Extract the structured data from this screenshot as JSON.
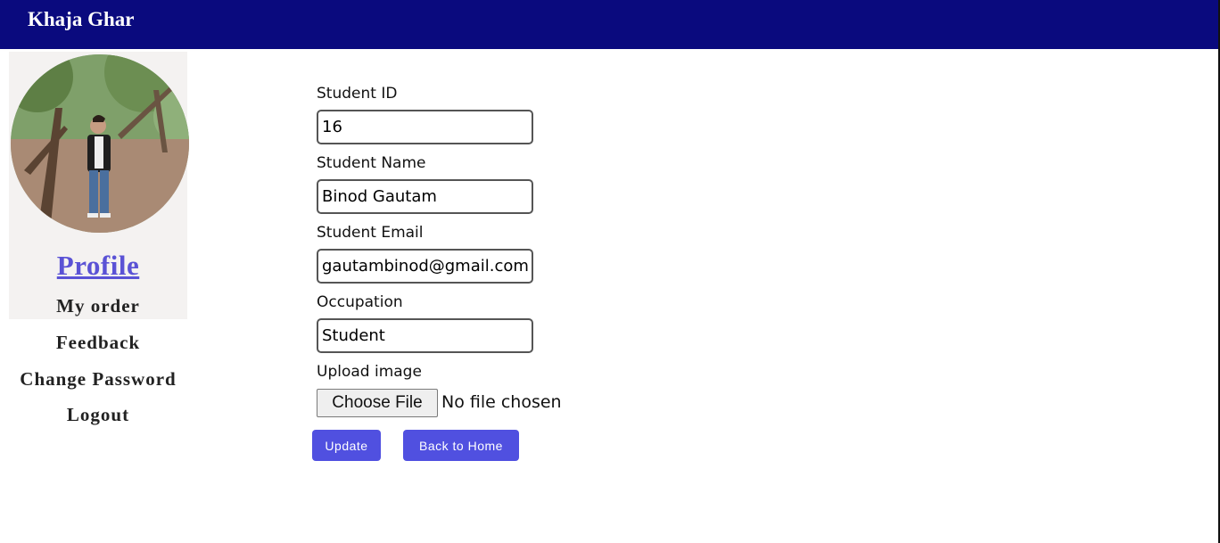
{
  "header": {
    "brand": "Khaja Ghar"
  },
  "sidebar": {
    "avatar_icon": "profile-photo",
    "items": [
      {
        "label": "Profile"
      },
      {
        "label": "My order"
      },
      {
        "label": "Feedback"
      },
      {
        "label": "Change Password"
      },
      {
        "label": "Logout"
      }
    ]
  },
  "form": {
    "student_id": {
      "label": "Student ID",
      "value": "16"
    },
    "student_name": {
      "label": "Student Name",
      "value": "Binod Gautam"
    },
    "student_email": {
      "label": "Student Email",
      "value": "gautambinod@gmail.com"
    },
    "occupation": {
      "label": "Occupation",
      "value": "Student"
    },
    "upload": {
      "label": "Upload image",
      "button": "Choose File",
      "status": "No file chosen"
    },
    "update_label": "Update",
    "back_label": "Back to Home"
  },
  "colors": {
    "header_bg": "#0a0a7e",
    "accent": "#5050e0",
    "profile_link": "#5a52d5",
    "sidebar_bg": "#f4f2f1"
  }
}
